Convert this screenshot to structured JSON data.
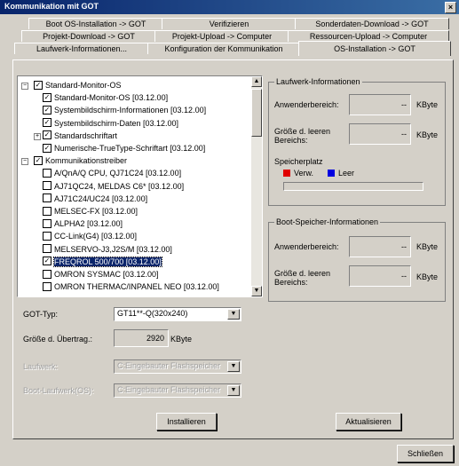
{
  "window": {
    "title": "Kommunikation mit GOT",
    "close_glyph": "×"
  },
  "tabs": {
    "row1": [
      "Boot OS-Installation -> GOT",
      "Verifizieren",
      "Sonderdaten-Download -> GOT"
    ],
    "row2": [
      "Projekt-Download -> GOT",
      "Projekt-Upload -> Computer",
      "Ressourcen-Upload -> Computer"
    ],
    "row3": [
      "Laufwerk-Informationen...",
      "Konfiguration der Kommunikation",
      "OS-Installation -> GOT"
    ]
  },
  "tree": {
    "items": [
      {
        "label": "Standard-Monitor-OS",
        "level": 0,
        "expander": "minus",
        "checked": true
      },
      {
        "label": "Standard-Monitor-OS [03.12.00]",
        "level": 1,
        "checked": true
      },
      {
        "label": "Systembildschirm-Informationen [03.12.00]",
        "level": 1,
        "checked": true
      },
      {
        "label": "Systembildschirm-Daten [03.12.00]",
        "level": 1,
        "checked": true
      },
      {
        "label": "Standardschriftart",
        "level": 1,
        "expander": "plus",
        "checked": true
      },
      {
        "label": "Numerische-TrueType-Schriftart [03.12.00]",
        "level": 1,
        "checked": true
      },
      {
        "label": "Kommunikationstreiber",
        "level": 0,
        "expander": "minus",
        "checked": true
      },
      {
        "label": "A/QnA/Q CPU, QJ71C24 [03.12.00]",
        "level": 1,
        "checked": false
      },
      {
        "label": "AJ71QC24, MELDAS C6* [03.12.00]",
        "level": 1,
        "checked": false
      },
      {
        "label": "AJ71C24/UC24 [03.12.00]",
        "level": 1,
        "checked": false
      },
      {
        "label": "MELSEC-FX [03.12.00]",
        "level": 1,
        "checked": false
      },
      {
        "label": "ALPHA2 [03.12.00]",
        "level": 1,
        "checked": false
      },
      {
        "label": "CC-Link(G4) [03.12.00]",
        "level": 1,
        "checked": false
      },
      {
        "label": "MELSERVO-J3,J2S/M [03.12.00]",
        "level": 1,
        "checked": false
      },
      {
        "label": "FREQROL 500/700 [03.12.00]",
        "level": 1,
        "checked": true,
        "selected": true
      },
      {
        "label": "OMRON SYSMAC [03.12.00]",
        "level": 1,
        "checked": false
      },
      {
        "label": "OMRON THERMAC/INPANEL NEO [03.12.00]",
        "level": 1,
        "checked": false
      }
    ]
  },
  "drive_info": {
    "title": "Laufwerk-Informationen",
    "user_area_label": "Anwenderbereich:",
    "user_area_value": "--",
    "user_area_unit": "KByte",
    "free_area_label": "Größe d. leeren Bereichs:",
    "free_area_value": "--",
    "free_area_unit": "KByte",
    "storage_label": "Speicherplatz",
    "legend_used": "Verw.",
    "legend_free": "Leer",
    "used_color": "#e00000",
    "free_color": "#0000e0"
  },
  "boot_info": {
    "title": "Boot-Speicher-Informationen",
    "user_area_label": "Anwenderbereich:",
    "user_area_value": "--",
    "user_area_unit": "KByte",
    "free_area_label": "Größe d. leeren Bereichs:",
    "free_area_value": "--",
    "free_area_unit": "KByte"
  },
  "form": {
    "got_type_label": "GOT-Typ:",
    "got_type_value": "GT11**-Q(320x240)",
    "transfer_size_label": "Größe d. Übertrag.:",
    "transfer_size_value": "2920",
    "transfer_size_unit": "KByte",
    "drive_label": "Laufwerk:",
    "drive_value": "C:Eingebauter Flashspeicher",
    "boot_drive_label": "Boot-Laufwerk(OS):",
    "boot_drive_value": "C:Eingebauter Flashspeicher"
  },
  "buttons": {
    "install": "Installieren",
    "refresh": "Aktualisieren",
    "close": "Schließen"
  },
  "icons": {
    "dropdown": "▼",
    "scroll_up": "▲",
    "scroll_down": "▼",
    "check": "✓",
    "minus": "−",
    "plus": "+"
  }
}
